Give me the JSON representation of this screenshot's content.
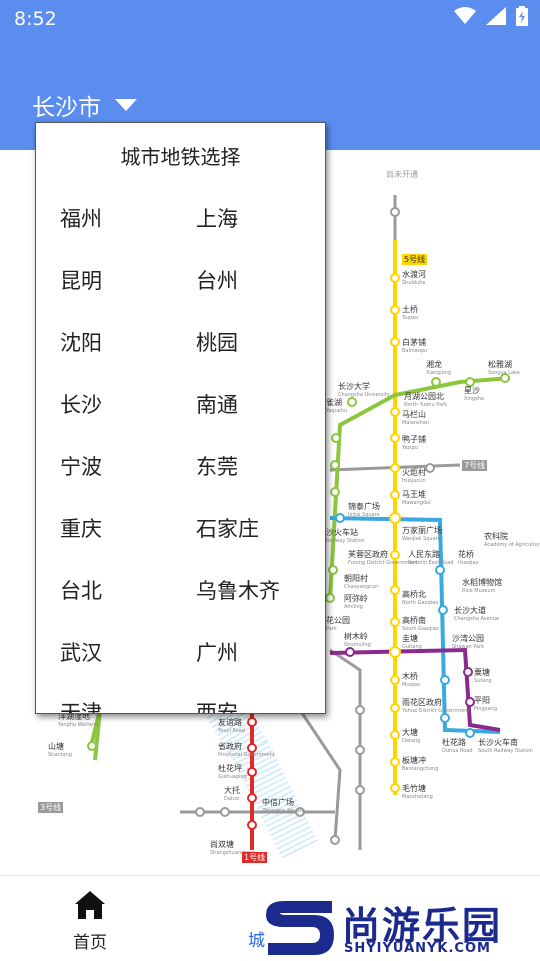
{
  "status_bar": {
    "time": "8:52"
  },
  "header": {
    "city": "长沙市"
  },
  "popup": {
    "title": "城市地铁选择",
    "cities": [
      "福州",
      "上海",
      "昆明",
      "台州",
      "沈阳",
      "桃园",
      "长沙",
      "南通",
      "宁波",
      "东莞",
      "重庆",
      "石家庄",
      "台北",
      "乌鲁木齐",
      "武汉",
      "广州",
      "天津",
      "西安"
    ]
  },
  "map": {
    "stations": [
      {
        "name": "水渡河",
        "en": "Shuiduhe"
      },
      {
        "name": "土桥",
        "en": "Tuqiao"
      },
      {
        "name": "白茅铺",
        "en": "Baimaopu"
      },
      {
        "name": "湘龙",
        "en": "Xianglong"
      },
      {
        "name": "松雅湖",
        "en": "Songya Lake"
      },
      {
        "name": "长沙大学",
        "en": "Changsha University"
      },
      {
        "name": "月湖公园北",
        "en": "North Yuehu Park"
      },
      {
        "name": "星沙",
        "en": "Xingsha"
      },
      {
        "name": "雀湖",
        "en": "Yaquehu"
      },
      {
        "name": "马栏山",
        "en": "Malanshan"
      },
      {
        "name": "鸭子铺",
        "en": "Yazipu"
      },
      {
        "name": "火炬村",
        "en": "Huojucun"
      },
      {
        "name": "马王堆",
        "en": "Mawangdui"
      },
      {
        "name": "锦泰广场",
        "en": "Jintai Square"
      },
      {
        "name": "万家丽广场",
        "en": "Wanjiali Square"
      },
      {
        "name": "芙蓉区政府",
        "en": "Furong District Government"
      },
      {
        "name": "人民东路",
        "en": "Renmin East Road"
      },
      {
        "name": "花桥",
        "en": "Huaqiao"
      },
      {
        "name": "朝阳村",
        "en": "Chaoyangcun"
      },
      {
        "name": "阿弥岭",
        "en": "Amiling"
      },
      {
        "name": "高桥北",
        "en": "North Gaoqiao"
      },
      {
        "name": "长沙大道",
        "en": "Changsha Avenue"
      },
      {
        "name": "高桥南",
        "en": "South Gaoqiao"
      },
      {
        "name": "树木岭",
        "en": "Shumuling"
      },
      {
        "name": "圭塘",
        "en": "Guitang"
      },
      {
        "name": "沙湾公园",
        "en": "Shawan Park"
      },
      {
        "name": "花公园",
        "en": "Park"
      },
      {
        "name": "粟塘",
        "en": "Sutang"
      },
      {
        "name": "木桥",
        "en": "Muqiao"
      },
      {
        "name": "平阳",
        "en": "Pingyang"
      },
      {
        "name": "雨花区政府",
        "en": "Yuhua District Government"
      },
      {
        "name": "大塘",
        "en": "Datang"
      },
      {
        "name": "杜花路",
        "en": "Duhua Road"
      },
      {
        "name": "长沙火车南",
        "en": "South Railway Station"
      },
      {
        "name": "板塘冲",
        "en": "Bantangchong"
      },
      {
        "name": "毛竹塘",
        "en": "Maozhutang"
      },
      {
        "name": "友谊路",
        "en": "Youyi Road"
      },
      {
        "name": "省政府",
        "en": "Provincial Government"
      },
      {
        "name": "杜花坪",
        "en": "Guihuaping"
      },
      {
        "name": "大托",
        "en": "Datuo"
      },
      {
        "name": "中信广场",
        "en": "Zhongxin Square"
      },
      {
        "name": "尚双塘",
        "en": "Shangshuangtang"
      },
      {
        "name": "洋湖湿地",
        "en": "Yanghu Wetland"
      },
      {
        "name": "山塘",
        "en": "Shantang"
      },
      {
        "name": "沙火车站",
        "en": "Railway Station"
      },
      {
        "name": "农科院",
        "en": "Academy of Agricultural Sciences"
      },
      {
        "name": "水稻博物馆",
        "en": "Rice Museum"
      }
    ],
    "markers": [
      "尚未开通",
      "5号线",
      "7号线",
      "1号线",
      "3号线"
    ]
  },
  "bottom_nav": {
    "home_label": "首页",
    "city_label": "城"
  },
  "watermark": {
    "brand": "尚游乐园",
    "url": "SHYIYUANYK.COM"
  },
  "colors": {
    "header": "#5b8def",
    "line1": "#e02a2a",
    "line2": "#3aa9df",
    "line3": "#8cc63f",
    "line4": "#8a2a8e",
    "line5": "#ffd400",
    "unopened": "#9a9a9a"
  }
}
